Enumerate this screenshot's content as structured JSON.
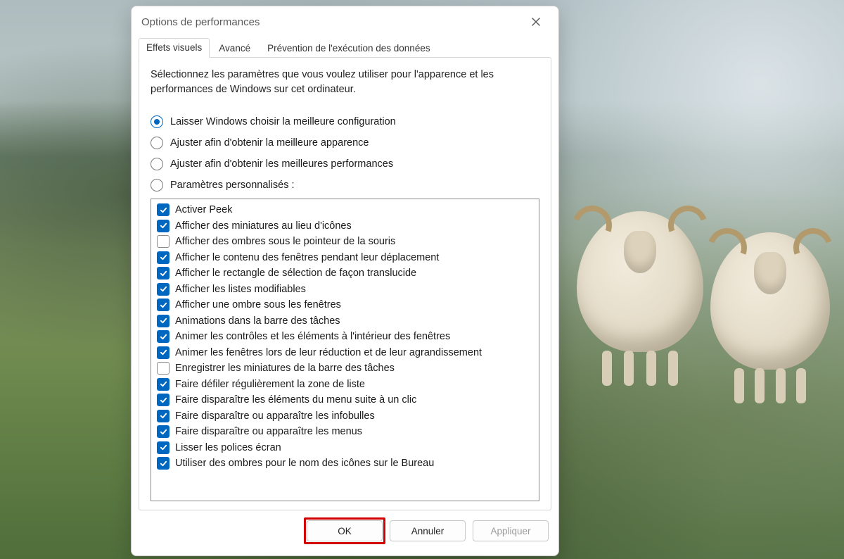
{
  "window": {
    "title": "Options de performances"
  },
  "tabs": [
    {
      "label": "Effets visuels",
      "active": true
    },
    {
      "label": "Avancé",
      "active": false
    },
    {
      "label": "Prévention de l'exécution des données",
      "active": false
    }
  ],
  "intro": "Sélectionnez les paramètres que vous voulez utiliser pour l'apparence et les performances de Windows sur cet ordinateur.",
  "radios": [
    {
      "label": "Laisser Windows choisir la meilleure configuration",
      "selected": true
    },
    {
      "label": "Ajuster afin d'obtenir la meilleure apparence",
      "selected": false
    },
    {
      "label": "Ajuster afin d'obtenir les meilleures performances",
      "selected": false
    },
    {
      "label": "Paramètres personnalisés :",
      "selected": false
    }
  ],
  "options": [
    {
      "label": "Activer Peek",
      "checked": true
    },
    {
      "label": "Afficher des miniatures au lieu d'icônes",
      "checked": true
    },
    {
      "label": "Afficher des ombres sous le pointeur de la souris",
      "checked": false
    },
    {
      "label": "Afficher le contenu des fenêtres pendant leur déplacement",
      "checked": true
    },
    {
      "label": "Afficher le rectangle de sélection de façon translucide",
      "checked": true
    },
    {
      "label": "Afficher les listes modifiables",
      "checked": true
    },
    {
      "label": "Afficher une ombre sous les fenêtres",
      "checked": true
    },
    {
      "label": "Animations dans la barre des tâches",
      "checked": true
    },
    {
      "label": "Animer les contrôles et les éléments à l'intérieur des fenêtres",
      "checked": true
    },
    {
      "label": "Animer les fenêtres lors de leur réduction et de leur agrandissement",
      "checked": true
    },
    {
      "label": "Enregistrer les miniatures de la barre des tâches",
      "checked": false
    },
    {
      "label": "Faire défiler régulièrement la zone de liste",
      "checked": true
    },
    {
      "label": "Faire disparaître les éléments du menu suite à un clic",
      "checked": true
    },
    {
      "label": "Faire disparaître ou apparaître les infobulles",
      "checked": true
    },
    {
      "label": "Faire disparaître ou apparaître les menus",
      "checked": true
    },
    {
      "label": "Lisser les polices écran",
      "checked": true
    },
    {
      "label": "Utiliser des ombres pour le nom des icônes sur le Bureau",
      "checked": true
    }
  ],
  "buttons": {
    "ok": "OK",
    "cancel": "Annuler",
    "apply": "Appliquer"
  }
}
